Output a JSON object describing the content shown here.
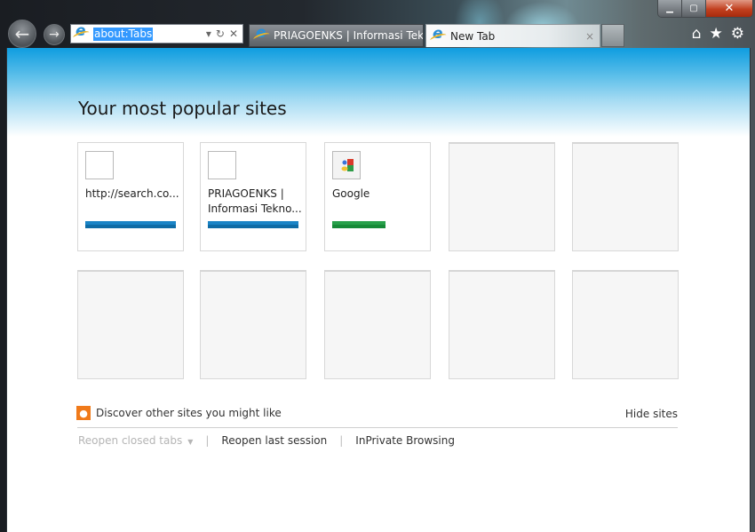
{
  "browser": {
    "address": {
      "value": "about:Tabs"
    },
    "tabs": [
      {
        "label": "PRIAGOENKS | Informasi Tekn...",
        "active": false
      },
      {
        "label": "New Tab",
        "active": true,
        "close": "×"
      }
    ],
    "window_controls": {
      "minimize": "▁",
      "maximize": "▢",
      "close": "✕"
    },
    "toolbar_icons": {
      "home": "⌂",
      "favorites": "★",
      "tools": "⚙"
    },
    "nav": {
      "back": "←",
      "forward": "→"
    },
    "addr_buttons": {
      "dropdown": "▾",
      "refresh": "↻",
      "stop": "✕"
    }
  },
  "page": {
    "heading": "Your most popular sites",
    "tiles": [
      {
        "title": "http://search.co...",
        "activity_color": "#1a84c6",
        "icon": "blank-favicon"
      },
      {
        "title": "PRIAGOENKS | Informasi Tekno...",
        "activity_color": "#1a84c6",
        "icon": "blank-favicon"
      },
      {
        "title": "Google",
        "activity_color": "#27a04a",
        "icon": "google-favicon"
      },
      {
        "title": ""
      },
      {
        "title": ""
      },
      {
        "title": ""
      },
      {
        "title": ""
      },
      {
        "title": ""
      },
      {
        "title": ""
      },
      {
        "title": ""
      }
    ],
    "discover": {
      "label": "Discover other sites you might like",
      "icon": "lightbulb"
    },
    "hide_sites": "Hide sites",
    "links": {
      "reopen_closed": "Reopen closed tabs",
      "reopen_last": "Reopen last session",
      "inprivate": "InPrivate Browsing",
      "separator": "|"
    }
  }
}
